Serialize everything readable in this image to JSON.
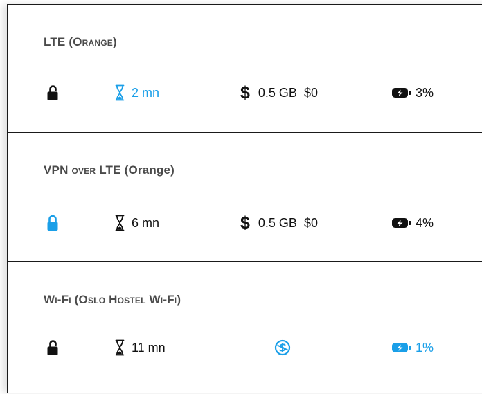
{
  "connections": [
    {
      "title_main": "LTE (",
      "title_small": "Orange",
      "title_end": ")",
      "lock_icon": "lock-open-icon",
      "lock_color": "#111111",
      "time_icon": "hourglass-icon",
      "time_color": "#1a9fe8",
      "time": "2 mn",
      "cost_icon": "dollar-icon",
      "data": "0.5 GB",
      "cost": "$0",
      "battery_icon": "battery-charging-icon",
      "battery_color": "#111111",
      "battery": "3%"
    },
    {
      "title_main": "VPN ",
      "title_small": "over",
      "title_end": " LTE (Orange)",
      "lock_icon": "lock-closed-icon",
      "lock_color": "#1a9fe8",
      "time_icon": "hourglass-icon",
      "time_color": "#111111",
      "time": "6 mn",
      "cost_icon": "dollar-icon",
      "data": "0.5 GB",
      "cost": "$0",
      "battery_icon": "battery-charging-icon",
      "battery_color": "#111111",
      "battery": "4%"
    },
    {
      "title_main": "Wi-Fi (Oslo Hostel Wi-Fi)",
      "lock_icon": "lock-open-icon",
      "lock_color": "#111111",
      "time_icon": "hourglass-icon",
      "time_color": "#111111",
      "time": "11 mn",
      "cost_icon": "no-cost-icon",
      "cost_color": "#1a9fe8",
      "battery_icon": "battery-charging-icon",
      "battery_color": "#1a9fe8",
      "battery": "1%"
    }
  ]
}
